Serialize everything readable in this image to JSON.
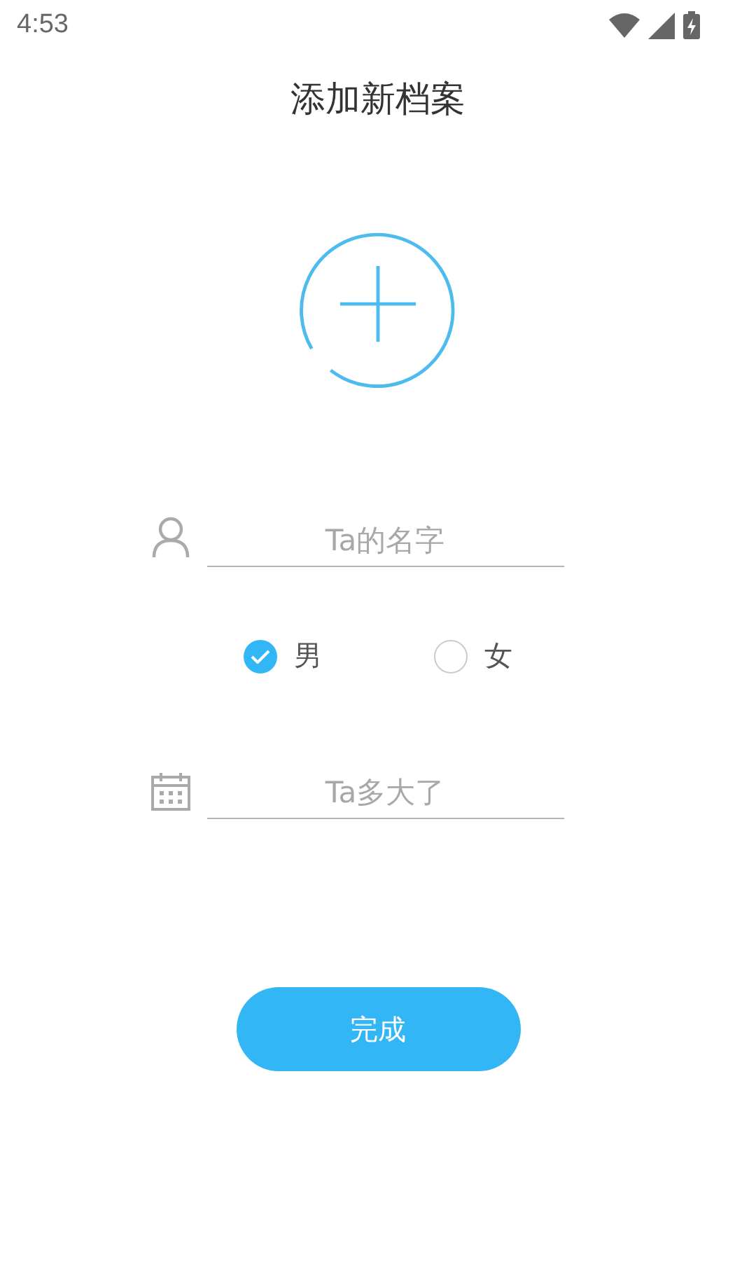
{
  "status_bar": {
    "time": "4:53"
  },
  "title": "添加新档案",
  "name_field": {
    "placeholder": "Ta的名字"
  },
  "gender_options": [
    {
      "label": "男",
      "selected": true
    },
    {
      "label": "女",
      "selected": false
    }
  ],
  "age_field": {
    "placeholder": "Ta多大了"
  },
  "submit_button": "完成"
}
